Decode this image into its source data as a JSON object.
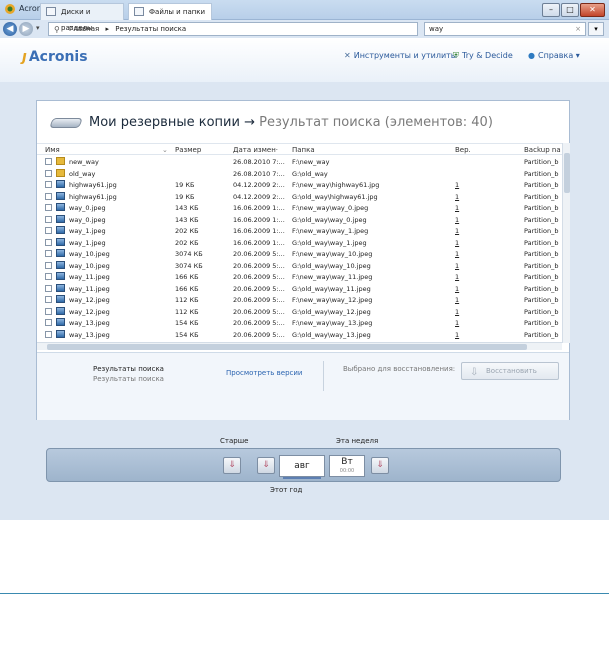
{
  "window": {
    "title": "Acronis True Image Home"
  },
  "address": {
    "home": "Главная",
    "separator": "▸",
    "current": "Результаты поиска",
    "search_value": "way",
    "clear": "×",
    "dropdown": "▾"
  },
  "header": {
    "logo": "Acronis",
    "links": [
      {
        "icon": "tools-icon",
        "label": "Инструменты и утилиты"
      },
      {
        "icon": "shield-icon",
        "label": "Try & Decide"
      },
      {
        "icon": "help-icon",
        "label": "Справка ▾"
      }
    ]
  },
  "tabs": [
    {
      "label": "Диски и разделы",
      "active": false
    },
    {
      "label": "Файлы и папки",
      "active": true
    }
  ],
  "page": {
    "title": "Мои резервные копии",
    "arrow": "→",
    "subtitle": "Результат поиска (элементов: 40)"
  },
  "columns": {
    "name": "Имя",
    "size": "Размер",
    "date": "Дата измен·",
    "folder": "Папка",
    "ver": "Вер.",
    "backup": "Backup na"
  },
  "rows": [
    {
      "type": "folder",
      "name": "new_way",
      "size": "",
      "date": "26.08.2010 7:...",
      "folder": "F:\\new_way",
      "ver": "",
      "backup": "Partition_b"
    },
    {
      "type": "folder",
      "name": "old_way",
      "size": "",
      "date": "26.08.2010 7:...",
      "folder": "G:\\old_way",
      "ver": "",
      "backup": "Partition_b"
    },
    {
      "type": "img",
      "name": "highway61.jpg",
      "size": "19 КБ",
      "date": "04.12.2009 2:...",
      "folder": "F:\\new_way\\highway61.jpg",
      "ver": "1",
      "backup": "Partition_b"
    },
    {
      "type": "img",
      "name": "highway61.jpg",
      "size": "19 КБ",
      "date": "04.12.2009 2:...",
      "folder": "G:\\old_way\\highway61.jpg",
      "ver": "1",
      "backup": "Partition_b"
    },
    {
      "type": "img",
      "name": "way_0.jpeg",
      "size": "143 КБ",
      "date": "16.06.2009 1:...",
      "folder": "F:\\new_way\\way_0.jpeg",
      "ver": "1",
      "backup": "Partition_b"
    },
    {
      "type": "img",
      "name": "way_0.jpeg",
      "size": "143 КБ",
      "date": "16.06.2009 1:...",
      "folder": "G:\\old_way\\way_0.jpeg",
      "ver": "1",
      "backup": "Partition_b"
    },
    {
      "type": "img",
      "name": "way_1.jpeg",
      "size": "202 КБ",
      "date": "16.06.2009 1:...",
      "folder": "F:\\new_way\\way_1.jpeg",
      "ver": "1",
      "backup": "Partition_b"
    },
    {
      "type": "img",
      "name": "way_1.jpeg",
      "size": "202 КБ",
      "date": "16.06.2009 1:...",
      "folder": "G:\\old_way\\way_1.jpeg",
      "ver": "1",
      "backup": "Partition_b"
    },
    {
      "type": "img",
      "name": "way_10.jpeg",
      "size": "3074 КБ",
      "date": "20.06.2009 5:...",
      "folder": "F:\\new_way\\way_10.jpeg",
      "ver": "1",
      "backup": "Partition_b"
    },
    {
      "type": "img",
      "name": "way_10.jpeg",
      "size": "3074 КБ",
      "date": "20.06.2009 5:...",
      "folder": "G:\\old_way\\way_10.jpeg",
      "ver": "1",
      "backup": "Partition_b"
    },
    {
      "type": "img",
      "name": "way_11.jpeg",
      "size": "166 КБ",
      "date": "20.06.2009 5:...",
      "folder": "F:\\new_way\\way_11.jpeg",
      "ver": "1",
      "backup": "Partition_b"
    },
    {
      "type": "img",
      "name": "way_11.jpeg",
      "size": "166 КБ",
      "date": "20.06.2009 5:...",
      "folder": "G:\\old_way\\way_11.jpeg",
      "ver": "1",
      "backup": "Partition_b"
    },
    {
      "type": "img",
      "name": "way_12.jpeg",
      "size": "112 КБ",
      "date": "20.06.2009 5:...",
      "folder": "F:\\new_way\\way_12.jpeg",
      "ver": "1",
      "backup": "Partition_b"
    },
    {
      "type": "img",
      "name": "way_12.jpeg",
      "size": "112 КБ",
      "date": "20.06.2009 5:...",
      "folder": "G:\\old_way\\way_12.jpeg",
      "ver": "1",
      "backup": "Partition_b"
    },
    {
      "type": "img",
      "name": "way_13.jpeg",
      "size": "154 КБ",
      "date": "20.06.2009 5:...",
      "folder": "F:\\new_way\\way_13.jpeg",
      "ver": "1",
      "backup": "Partition_b"
    },
    {
      "type": "img",
      "name": "way_13.jpeg",
      "size": "154 КБ",
      "date": "20.06.2009 5:...",
      "folder": "G:\\old_way\\way_13.jpeg",
      "ver": "1",
      "backup": "Partition_b"
    },
    {
      "type": "img",
      "name": "way_14.jpeg",
      "size": "136 КБ",
      "date": "20.06.2009 5:...",
      "folder": "F:\\new_way\\way_14.jpeg",
      "ver": "1",
      "backup": "Partition_b"
    },
    {
      "type": "img",
      "name": "way_14.jpeg",
      "size": "136 КБ",
      "date": "20.06.2009 5:...",
      "folder": "G:\\old_way\\way_14.jpeg",
      "ver": "1",
      "backup": "Partition_b"
    }
  ],
  "bottom": {
    "title": "Результаты поиска",
    "subtitle": "Результаты поиска",
    "view_versions": "Просмотреть версии",
    "selected": "Выбрано для восстановления:",
    "restore": "Восстановить"
  },
  "timeline": {
    "older": "Старше",
    "this_week": "Эта неделя",
    "this_year": "Этот год",
    "month": "авг",
    "day": "Вт",
    "time": "00:00"
  },
  "colors": {
    "accent": "#2b64b0",
    "window_bg": "#dce6f2",
    "timeline_bg": "#9eb4cc"
  }
}
